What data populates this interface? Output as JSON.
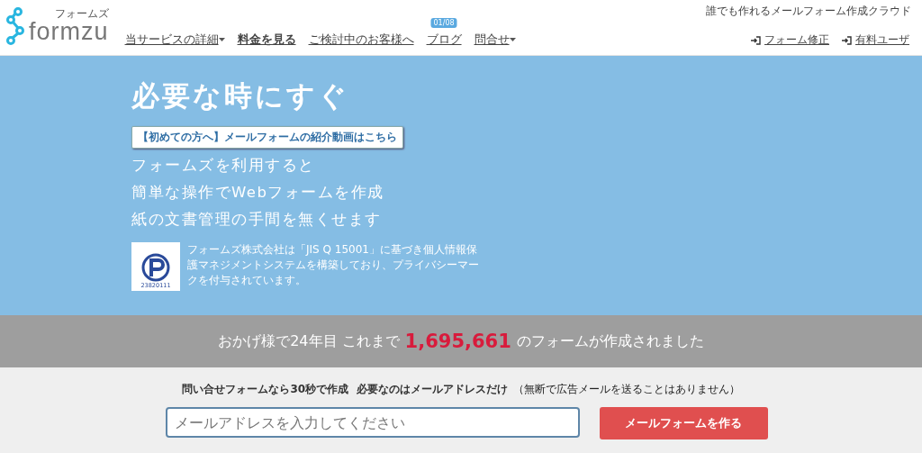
{
  "header": {
    "logo": {
      "text": "formzu",
      "kana": "フォームズ"
    },
    "tagline": "誰でも作れるメールフォーム作成クラウド",
    "nav": [
      {
        "label": "当サービスの詳細",
        "dropdown": true,
        "bold": false
      },
      {
        "label": "料金を見る",
        "dropdown": false,
        "bold": true
      },
      {
        "label": "ご検討中のお客様へ",
        "dropdown": false,
        "bold": false
      },
      {
        "label": "ブログ",
        "dropdown": false,
        "bold": false,
        "badge": "01/08"
      },
      {
        "label": "問合せ",
        "dropdown": true,
        "bold": false
      }
    ],
    "account_links": [
      "フォーム修正",
      "有料ユーザ"
    ]
  },
  "hero": {
    "title": "必要な時にすぐ",
    "video_button": "【初めての方へ】メールフォームの紹介動画はこちら",
    "lines": [
      "フォームズを利用すると",
      "簡単な操作でWebフォームを作成",
      "紙の文書管理の手間を無くせます"
    ],
    "privacy": {
      "mark_number": "23820111",
      "text": "フォームズ株式会社は「JIS Q 15001」に基づき個人情報保護マネジメントシステムを構築しており、プライバシーマークを付与されています。"
    }
  },
  "stats": {
    "before": "おかげ様で24年目 これまで",
    "count": "1,695,661",
    "after": "のフォームが作成されました"
  },
  "signup": {
    "heading": "問い合せフォームなら30秒で作成  必要なのはメールアドレスだけ",
    "note": "（無断で広告メールを送ることはありません）",
    "email_placeholder": "メールアドレスを入力してください",
    "button": "メールフォームを作る"
  }
}
